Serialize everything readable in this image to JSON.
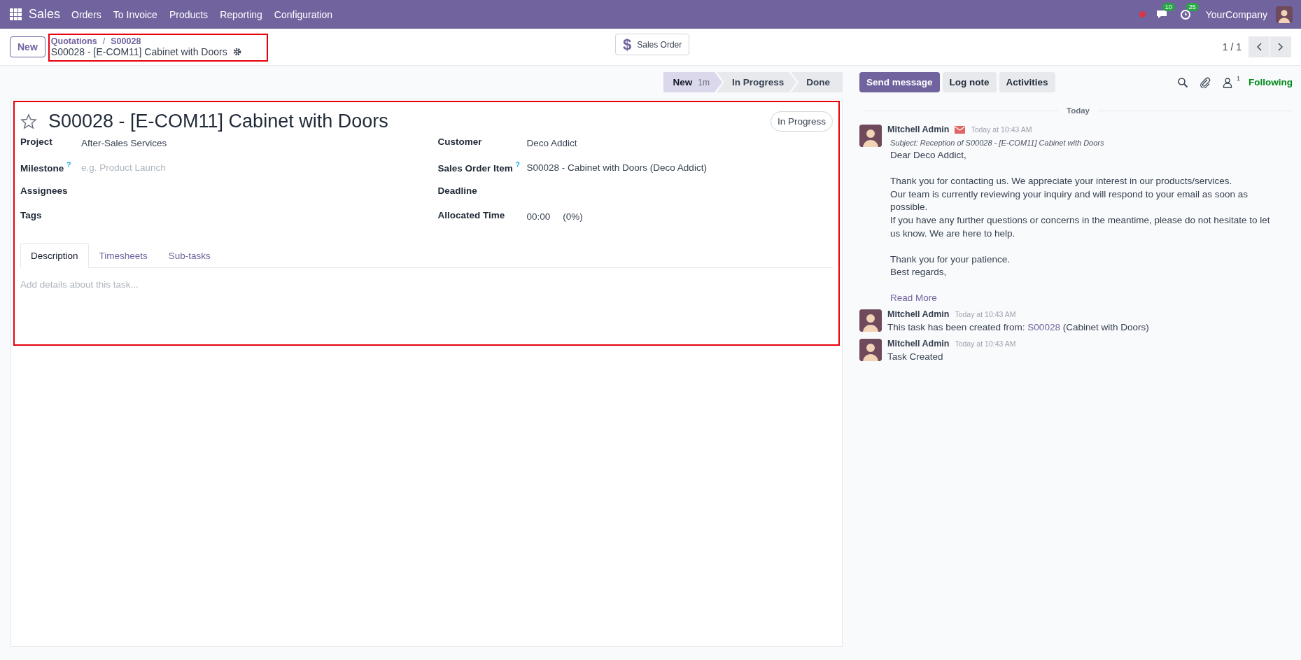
{
  "navbar": {
    "app": "Sales",
    "menu": [
      "Orders",
      "To Invoice",
      "Products",
      "Reporting",
      "Configuration"
    ],
    "messages_count": "10",
    "activities_count": "25",
    "company": "YourCompany"
  },
  "control_panel": {
    "new_button": "New",
    "breadcrumbs": [
      "Quotations",
      "S00028"
    ],
    "breadcrumb_separator": "/",
    "record_title": "S00028 - [E-COM11] Cabinet with Doors",
    "smart_button": {
      "icon": "$",
      "label": "Sales Order"
    },
    "pager": "1 / 1"
  },
  "statusbar": [
    {
      "label": "New",
      "duration": "1m",
      "selected": true
    },
    {
      "label": "In Progress",
      "selected": false
    },
    {
      "label": "Done",
      "selected": false
    }
  ],
  "form": {
    "starred": false,
    "title": "S00028 - [E-COM11] Cabinet with Doors",
    "stage_badge": "In Progress",
    "left_fields": [
      {
        "label": "Project",
        "value": "After-Sales Services"
      },
      {
        "label": "Milestone",
        "help": "?",
        "placeholder": "e.g. Product Launch"
      },
      {
        "label": "Assignees"
      },
      {
        "label": "Tags"
      }
    ],
    "right_fields": [
      {
        "label": "Customer",
        "value": "Deco Addict"
      },
      {
        "label": "Sales Order Item",
        "help": "?",
        "value": "S00028 - Cabinet with Doors (Deco Addict)"
      },
      {
        "label": "Deadline"
      },
      {
        "label": "Allocated Time",
        "value": "00:00",
        "extra": "(0%)"
      }
    ],
    "tabs": [
      {
        "label": "Description",
        "selected": true
      },
      {
        "label": "Timesheets",
        "selected": false
      },
      {
        "label": "Sub-tasks",
        "selected": false
      }
    ],
    "description_placeholder": "Add details about this task..."
  },
  "chatter": {
    "buttons": [
      {
        "label": "Send message",
        "selected": true
      },
      {
        "label": "Log note",
        "selected": false
      },
      {
        "label": "Activities",
        "selected": false
      }
    ],
    "followers_count": "1",
    "follow_label": "Following",
    "date_separator": "Today",
    "messages": [
      {
        "author": "Mitchell Admin",
        "via_email": true,
        "time": "Today at 10:43 AM",
        "subject": "Subject: Reception of S00028 - [E-COM11] Cabinet with Doors",
        "paragraphs": [
          [
            "Dear Deco Addict,"
          ],
          [
            "Thank you for contacting us. We appreciate your interest in our products/services.",
            "Our team is currently reviewing your inquiry and will respond to your email as soon as possible.",
            "If you have any further questions or concerns in the meantime, please do not hesitate to let us know. We are here to help."
          ],
          [
            "Thank you for your patience.",
            "Best regards,"
          ]
        ],
        "read_more": "Read More"
      },
      {
        "author": "Mitchell Admin",
        "via_email": false,
        "time": "Today at 10:43 AM",
        "text": "This task has been created from:",
        "link": "S00028",
        "text_after": "(Cabinet with Doors)"
      },
      {
        "author": "Mitchell Admin",
        "via_email": false,
        "time": "Today at 10:43 AM",
        "text": "Task Created"
      }
    ]
  }
}
